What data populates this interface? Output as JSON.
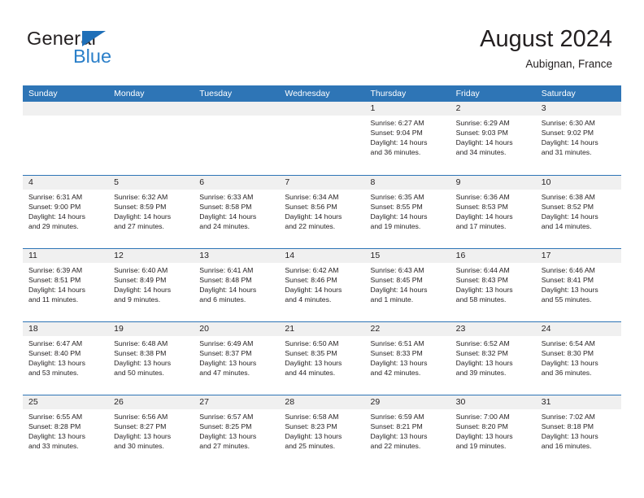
{
  "brand": {
    "name_part1": "General",
    "name_part2": "Blue",
    "triangle_color": "#1e6fb8",
    "blue_text_color": "#2a7fc9"
  },
  "header": {
    "month_title": "August 2024",
    "location": "Aubignan, France",
    "header_bg": "#2e75b6",
    "day_band_bg": "#f0f0f0"
  },
  "weekday_headers": [
    "Sunday",
    "Monday",
    "Tuesday",
    "Wednesday",
    "Thursday",
    "Friday",
    "Saturday"
  ],
  "weeks": [
    [
      {
        "day": "",
        "lines": []
      },
      {
        "day": "",
        "lines": []
      },
      {
        "day": "",
        "lines": []
      },
      {
        "day": "",
        "lines": []
      },
      {
        "day": "1",
        "lines": [
          "Sunrise: 6:27 AM",
          "Sunset: 9:04 PM",
          "Daylight: 14 hours",
          "and 36 minutes."
        ]
      },
      {
        "day": "2",
        "lines": [
          "Sunrise: 6:29 AM",
          "Sunset: 9:03 PM",
          "Daylight: 14 hours",
          "and 34 minutes."
        ]
      },
      {
        "day": "3",
        "lines": [
          "Sunrise: 6:30 AM",
          "Sunset: 9:02 PM",
          "Daylight: 14 hours",
          "and 31 minutes."
        ]
      }
    ],
    [
      {
        "day": "4",
        "lines": [
          "Sunrise: 6:31 AM",
          "Sunset: 9:00 PM",
          "Daylight: 14 hours",
          "and 29 minutes."
        ]
      },
      {
        "day": "5",
        "lines": [
          "Sunrise: 6:32 AM",
          "Sunset: 8:59 PM",
          "Daylight: 14 hours",
          "and 27 minutes."
        ]
      },
      {
        "day": "6",
        "lines": [
          "Sunrise: 6:33 AM",
          "Sunset: 8:58 PM",
          "Daylight: 14 hours",
          "and 24 minutes."
        ]
      },
      {
        "day": "7",
        "lines": [
          "Sunrise: 6:34 AM",
          "Sunset: 8:56 PM",
          "Daylight: 14 hours",
          "and 22 minutes."
        ]
      },
      {
        "day": "8",
        "lines": [
          "Sunrise: 6:35 AM",
          "Sunset: 8:55 PM",
          "Daylight: 14 hours",
          "and 19 minutes."
        ]
      },
      {
        "day": "9",
        "lines": [
          "Sunrise: 6:36 AM",
          "Sunset: 8:53 PM",
          "Daylight: 14 hours",
          "and 17 minutes."
        ]
      },
      {
        "day": "10",
        "lines": [
          "Sunrise: 6:38 AM",
          "Sunset: 8:52 PM",
          "Daylight: 14 hours",
          "and 14 minutes."
        ]
      }
    ],
    [
      {
        "day": "11",
        "lines": [
          "Sunrise: 6:39 AM",
          "Sunset: 8:51 PM",
          "Daylight: 14 hours",
          "and 11 minutes."
        ]
      },
      {
        "day": "12",
        "lines": [
          "Sunrise: 6:40 AM",
          "Sunset: 8:49 PM",
          "Daylight: 14 hours",
          "and 9 minutes."
        ]
      },
      {
        "day": "13",
        "lines": [
          "Sunrise: 6:41 AM",
          "Sunset: 8:48 PM",
          "Daylight: 14 hours",
          "and 6 minutes."
        ]
      },
      {
        "day": "14",
        "lines": [
          "Sunrise: 6:42 AM",
          "Sunset: 8:46 PM",
          "Daylight: 14 hours",
          "and 4 minutes."
        ]
      },
      {
        "day": "15",
        "lines": [
          "Sunrise: 6:43 AM",
          "Sunset: 8:45 PM",
          "Daylight: 14 hours",
          "and 1 minute."
        ]
      },
      {
        "day": "16",
        "lines": [
          "Sunrise: 6:44 AM",
          "Sunset: 8:43 PM",
          "Daylight: 13 hours",
          "and 58 minutes."
        ]
      },
      {
        "day": "17",
        "lines": [
          "Sunrise: 6:46 AM",
          "Sunset: 8:41 PM",
          "Daylight: 13 hours",
          "and 55 minutes."
        ]
      }
    ],
    [
      {
        "day": "18",
        "lines": [
          "Sunrise: 6:47 AM",
          "Sunset: 8:40 PM",
          "Daylight: 13 hours",
          "and 53 minutes."
        ]
      },
      {
        "day": "19",
        "lines": [
          "Sunrise: 6:48 AM",
          "Sunset: 8:38 PM",
          "Daylight: 13 hours",
          "and 50 minutes."
        ]
      },
      {
        "day": "20",
        "lines": [
          "Sunrise: 6:49 AM",
          "Sunset: 8:37 PM",
          "Daylight: 13 hours",
          "and 47 minutes."
        ]
      },
      {
        "day": "21",
        "lines": [
          "Sunrise: 6:50 AM",
          "Sunset: 8:35 PM",
          "Daylight: 13 hours",
          "and 44 minutes."
        ]
      },
      {
        "day": "22",
        "lines": [
          "Sunrise: 6:51 AM",
          "Sunset: 8:33 PM",
          "Daylight: 13 hours",
          "and 42 minutes."
        ]
      },
      {
        "day": "23",
        "lines": [
          "Sunrise: 6:52 AM",
          "Sunset: 8:32 PM",
          "Daylight: 13 hours",
          "and 39 minutes."
        ]
      },
      {
        "day": "24",
        "lines": [
          "Sunrise: 6:54 AM",
          "Sunset: 8:30 PM",
          "Daylight: 13 hours",
          "and 36 minutes."
        ]
      }
    ],
    [
      {
        "day": "25",
        "lines": [
          "Sunrise: 6:55 AM",
          "Sunset: 8:28 PM",
          "Daylight: 13 hours",
          "and 33 minutes."
        ]
      },
      {
        "day": "26",
        "lines": [
          "Sunrise: 6:56 AM",
          "Sunset: 8:27 PM",
          "Daylight: 13 hours",
          "and 30 minutes."
        ]
      },
      {
        "day": "27",
        "lines": [
          "Sunrise: 6:57 AM",
          "Sunset: 8:25 PM",
          "Daylight: 13 hours",
          "and 27 minutes."
        ]
      },
      {
        "day": "28",
        "lines": [
          "Sunrise: 6:58 AM",
          "Sunset: 8:23 PM",
          "Daylight: 13 hours",
          "and 25 minutes."
        ]
      },
      {
        "day": "29",
        "lines": [
          "Sunrise: 6:59 AM",
          "Sunset: 8:21 PM",
          "Daylight: 13 hours",
          "and 22 minutes."
        ]
      },
      {
        "day": "30",
        "lines": [
          "Sunrise: 7:00 AM",
          "Sunset: 8:20 PM",
          "Daylight: 13 hours",
          "and 19 minutes."
        ]
      },
      {
        "day": "31",
        "lines": [
          "Sunrise: 7:02 AM",
          "Sunset: 8:18 PM",
          "Daylight: 13 hours",
          "and 16 minutes."
        ]
      }
    ]
  ]
}
